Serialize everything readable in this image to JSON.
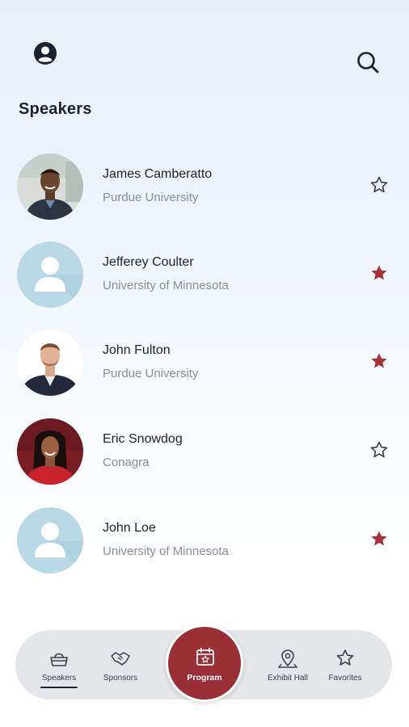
{
  "header": {
    "title": "Speakers",
    "profile_icon": "account-circle-icon",
    "search_icon": "search-icon"
  },
  "speakers": [
    {
      "name": "James Camberatto",
      "org": "Purdue University",
      "favorite": false,
      "avatar": "photo"
    },
    {
      "name": "Jefferey Coulter",
      "org": "University of Minnesota",
      "favorite": true,
      "avatar": "placeholder"
    },
    {
      "name": "John Fulton",
      "org": "Purdue University",
      "favorite": true,
      "avatar": "photo"
    },
    {
      "name": "Eric Snowdog",
      "org": "Conagra",
      "favorite": false,
      "avatar": "photo"
    },
    {
      "name": "John Loe",
      "org": "University of Minnesota",
      "favorite": true,
      "avatar": "placeholder"
    }
  ],
  "nav": {
    "items": [
      {
        "label": "Speakers",
        "icon": "basket-icon",
        "active": true
      },
      {
        "label": "Sponsors",
        "icon": "handshake-icon",
        "active": false
      },
      {
        "label": "Program",
        "icon": "calendar-star-icon",
        "active": false
      },
      {
        "label": "Exhibit Hall",
        "icon": "map-pin-icon",
        "active": false
      },
      {
        "label": "Favorites",
        "icon": "star-icon",
        "active": false
      }
    ]
  },
  "colors": {
    "accent": "#9a2f36",
    "favorite_star": "#a3323a",
    "text_primary": "#1c2230",
    "text_secondary": "#8a8e96",
    "nav_bg": "#e4e6ea",
    "placeholder_avatar_bg": "#b9d9e6"
  }
}
